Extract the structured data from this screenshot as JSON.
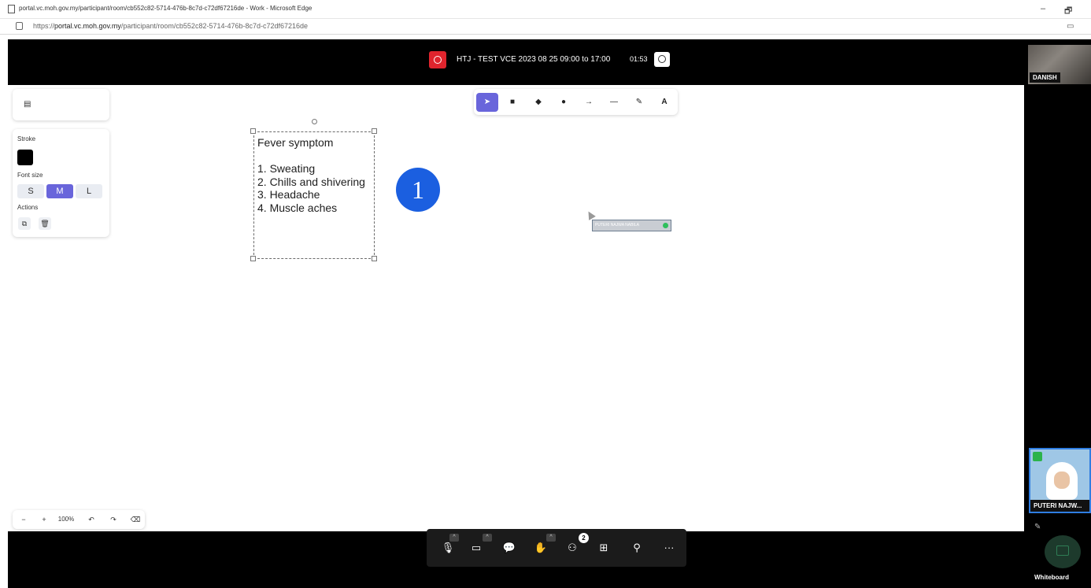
{
  "browser": {
    "title": "portal.vc.moh.gov.my/participant/room/cb552c82-5714-476b-8c7d-c72df67216de - Work - Microsoft Edge",
    "url_prefix": "https://",
    "url_host": "portal.vc.moh.gov.my",
    "url_path": "/participant/room/cb552c82-5714-476b-8c7d-c72df67216de",
    "minimize": "–",
    "restore": "🗗"
  },
  "meeting": {
    "title": "HTJ - TEST VCE 2023 08 25 09:00 to 17:00",
    "timer": "01:53"
  },
  "participants": {
    "top_name": "DANISH",
    "bottom_name": "PUTERI NAJW..."
  },
  "whiteboard_label": "Whiteboard",
  "props": {
    "stroke_label": "Stroke",
    "stroke_color": "#000000",
    "font_size_label": "Font size",
    "sizes": [
      "S",
      "M",
      "L"
    ],
    "active_size": "M",
    "actions_label": "Actions"
  },
  "zoom": {
    "minus": "−",
    "plus": "+",
    "level": "100%",
    "undo": "↶",
    "redo": "↷"
  },
  "note": {
    "text": "Fever symptom\n\n1. Sweating\n2. Chills and shivering\n3. Headache\n4. Muscle aches"
  },
  "annotation_number": "1",
  "collaborator_label": "PUTERI NAJWA NABILA",
  "participants_count": "2",
  "colors": {
    "accent": "#6965db",
    "record": "#e0242d",
    "badge_blue": "#1b5fe0",
    "online": "#2fbf5b"
  }
}
